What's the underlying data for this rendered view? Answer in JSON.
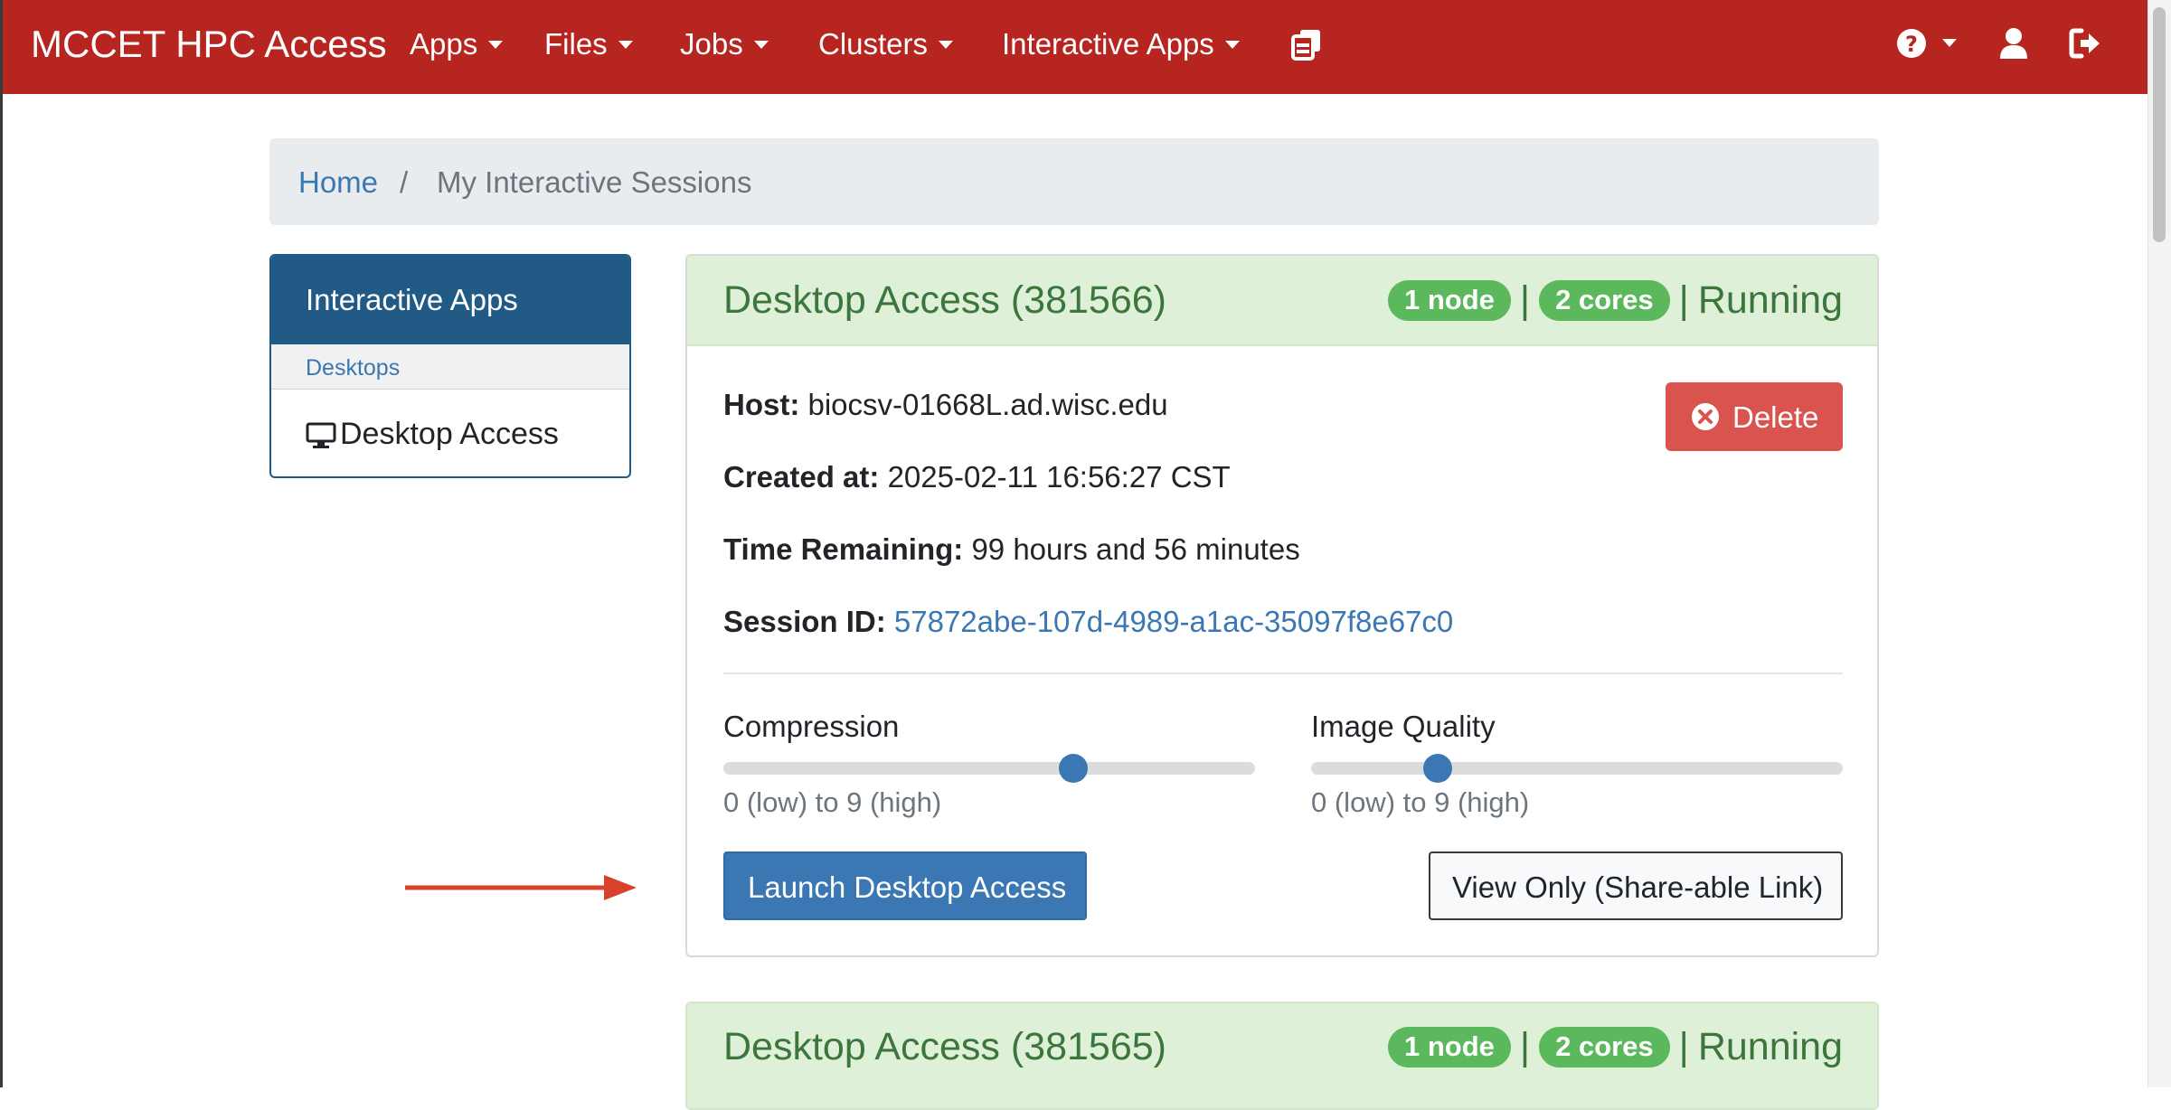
{
  "navbar": {
    "brand": "MCCET HPC Access",
    "menus": [
      {
        "label": "Apps"
      },
      {
        "label": "Files"
      },
      {
        "label": "Jobs"
      },
      {
        "label": "Clusters"
      },
      {
        "label": "Interactive Apps"
      }
    ],
    "icons": [
      "sessions-icon",
      "help-icon",
      "user-icon",
      "logout-icon"
    ],
    "color": "#b72520"
  },
  "breadcrumb": {
    "home": "Home",
    "separator": "/",
    "current": "My Interactive Sessions"
  },
  "sidebar": {
    "title": "Interactive Apps",
    "category": "Desktops",
    "item": "Desktop Access"
  },
  "sessions": [
    {
      "title": "Desktop Access (381566)",
      "nodes": "1 node",
      "cores": "2 cores",
      "separator": "|",
      "status": "Running",
      "host_label": "Host:",
      "host": "biocsv-01668L.ad.wisc.edu",
      "created_label": "Created at:",
      "created": "2025-02-11 16:56:27 CST",
      "remaining_label": "Time Remaining:",
      "remaining": "99 hours and 56 minutes",
      "session_label": "Session ID:",
      "session_id": "57872abe-107d-4989-a1ac-35097f8e67c0",
      "delete_label": "Delete",
      "compression": {
        "label": "Compression",
        "help": "0 (low) to 9 (high)",
        "value": 6,
        "min": 0,
        "max": 9
      },
      "quality": {
        "label": "Image Quality",
        "help": "0 (low) to 9 (high)",
        "value": 2,
        "min": 0,
        "max": 9
      },
      "launch_label": "Launch Desktop Access",
      "view_only_label": "View Only (Share-able Link)"
    },
    {
      "title": "Desktop Access (381565)",
      "nodes": "1 node",
      "cores": "2 cores",
      "separator": "|",
      "status": "Running"
    }
  ],
  "annotation": {
    "arrow_color": "#d9412b"
  }
}
